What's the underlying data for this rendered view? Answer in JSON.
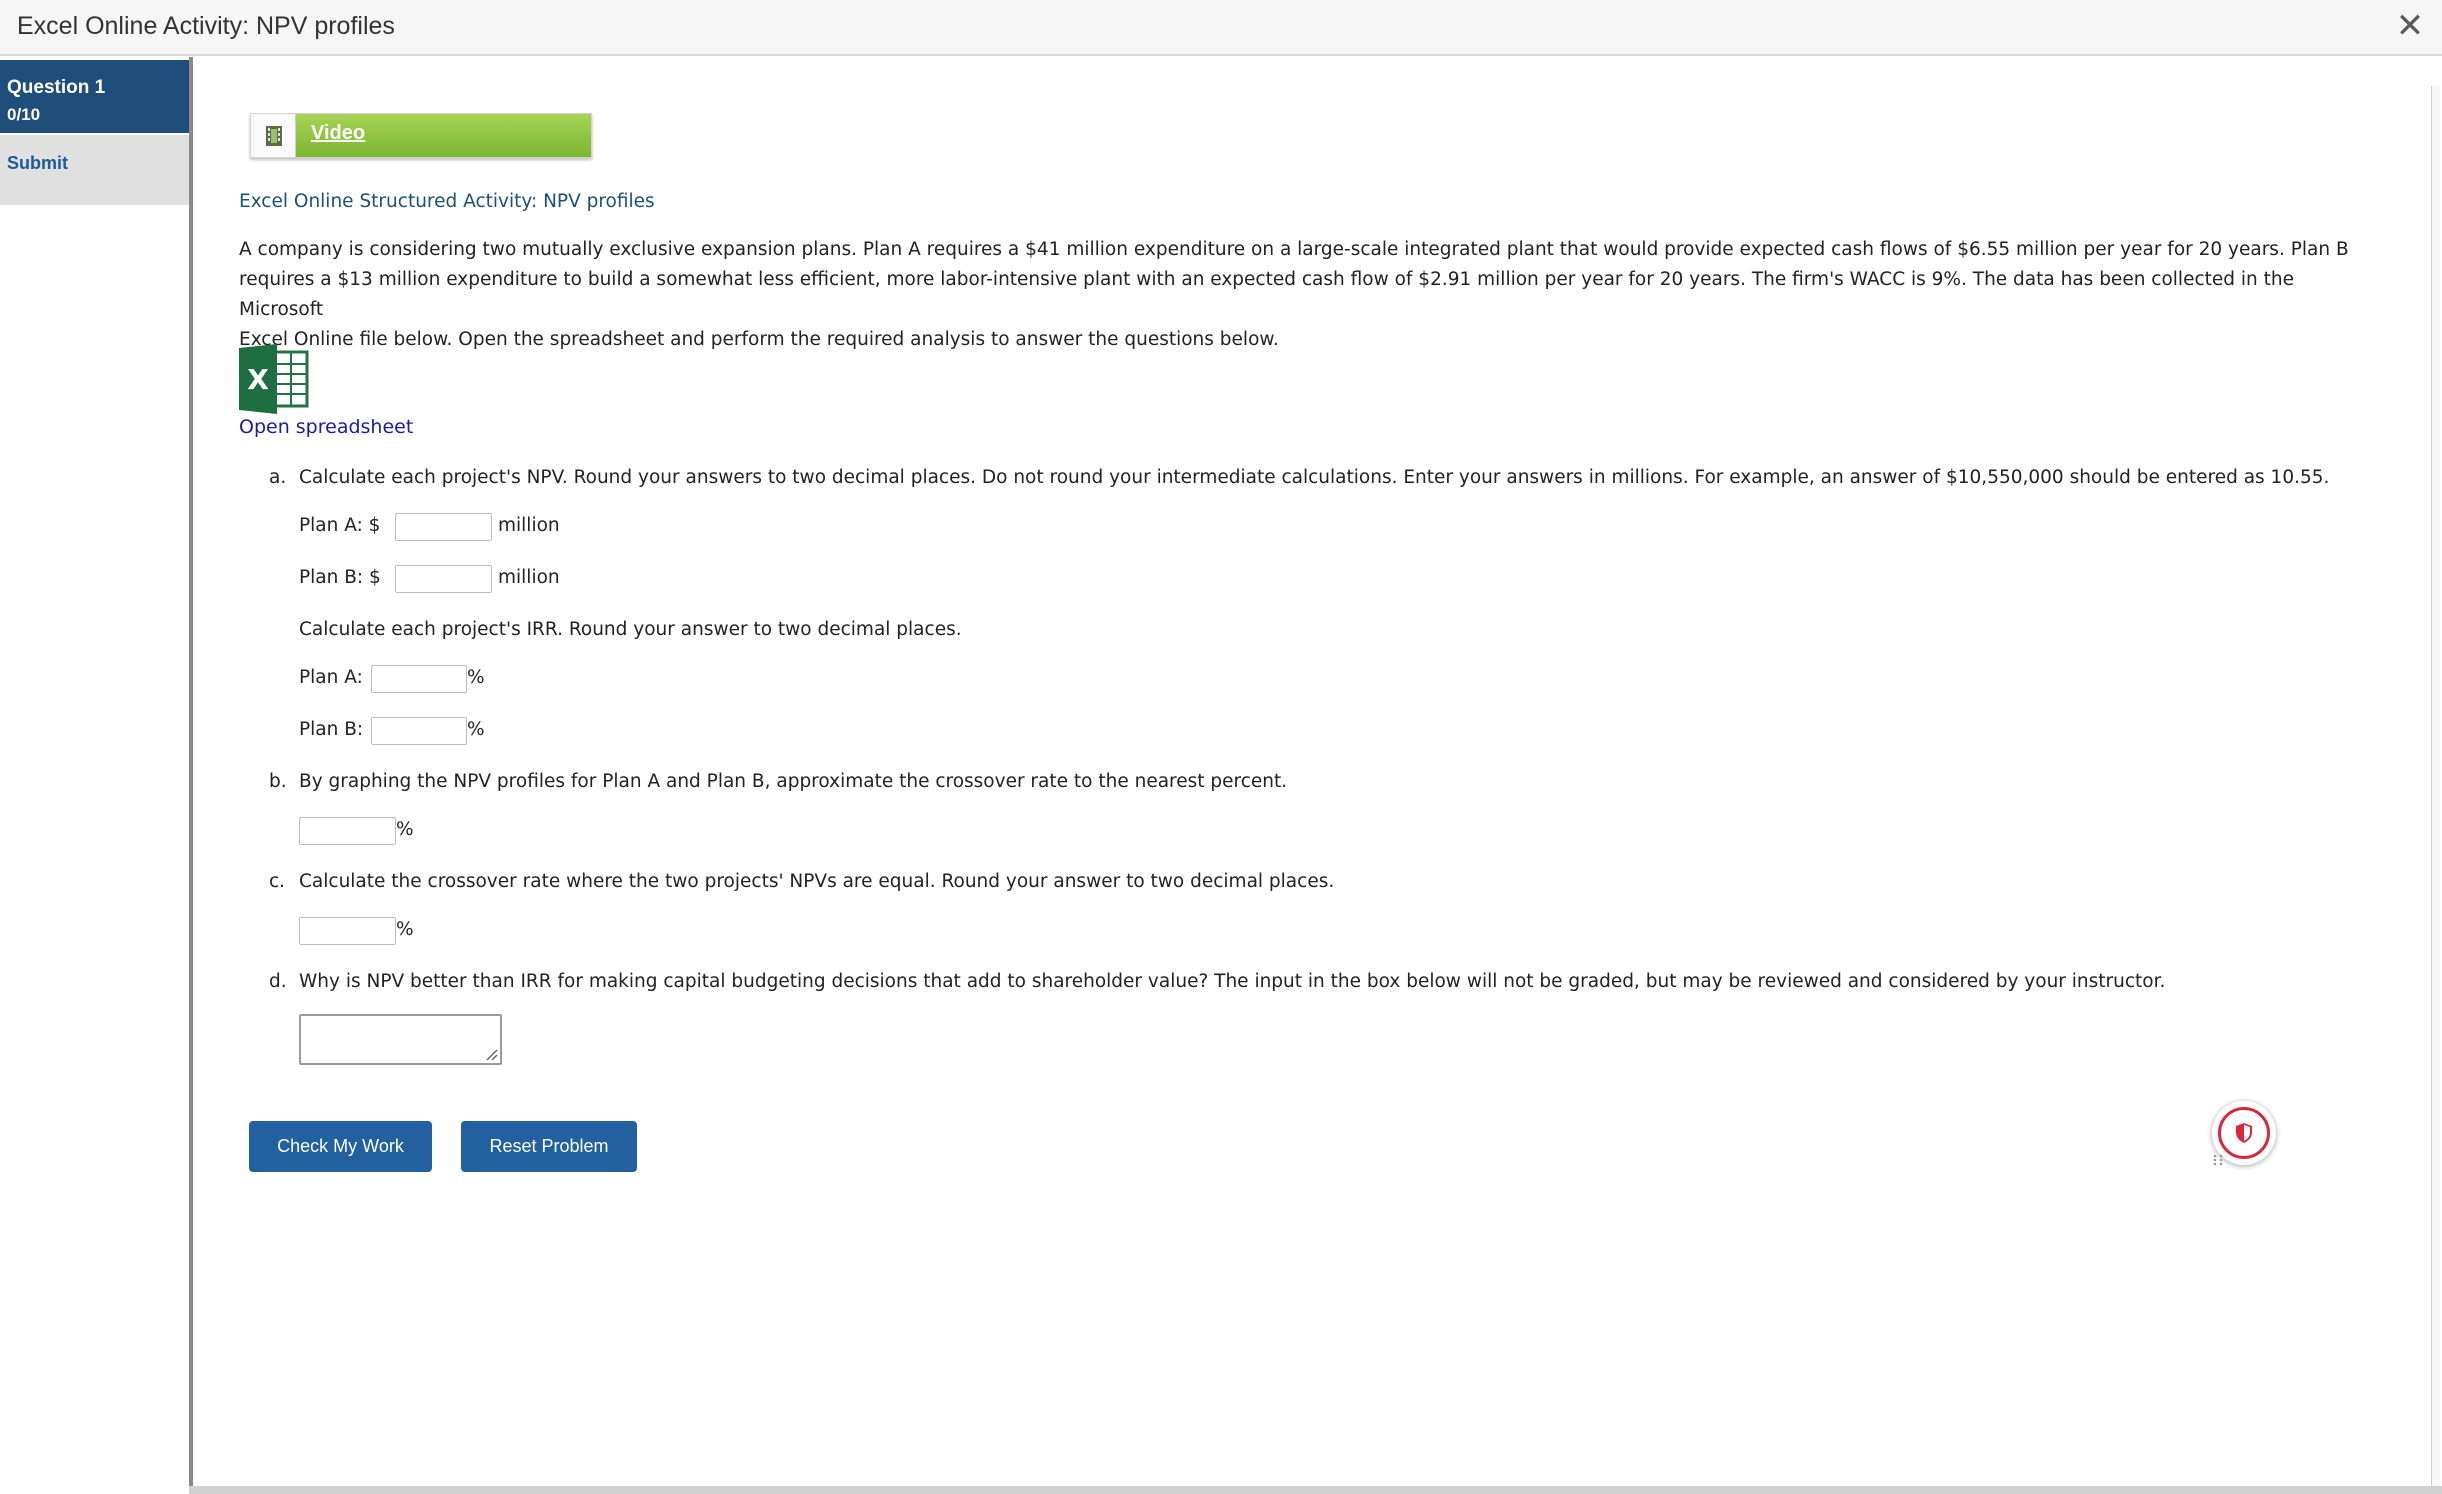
{
  "window": {
    "title": "Excel Online Activity: NPV profiles",
    "close_icon": "close-x-icon"
  },
  "sidebar": {
    "question_label": "Question 1",
    "score": "0/10",
    "submit_label": "Submit"
  },
  "video": {
    "label": "Video",
    "icon": "film-strip-icon"
  },
  "activity": {
    "title": "Excel Online Structured Activity: NPV profiles",
    "intro_line1": "A company is considering two mutually exclusive expansion plans. Plan A requires a $41 million expenditure on a large-scale integrated plant that would provide expected cash flows of $6.55 million per year for 20 years. Plan B",
    "intro_line2": "requires a $13 million expenditure to build a somewhat less efficient, more labor-intensive plant with an expected cash flow of $2.91 million per year for 20 years. The firm's WACC is 9%. The data has been collected in the Microsoft",
    "intro_line3": "Excel Online file below. Open the spreadsheet and perform the required analysis to answer the questions below.",
    "excel_icon": "excel-icon",
    "open_link": "Open spreadsheet"
  },
  "questions": {
    "a": {
      "letter": "a.",
      "text": "Calculate each project's NPV. Round your answers to two decimal places. Do not round your intermediate calculations. Enter your answers in millions. For example, an answer of $10,550,000 should be entered as 10.55.",
      "plan_a_label": "Plan A: $",
      "plan_b_label": "Plan B: $",
      "unit": "million",
      "irr_text": "Calculate each project's IRR. Round your answer to two decimal places.",
      "irr_plan_a_label": "Plan A:",
      "irr_plan_b_label": "Plan B:",
      "percent": "%",
      "npv_a_value": "",
      "npv_b_value": "",
      "irr_a_value": "",
      "irr_b_value": ""
    },
    "b": {
      "letter": "b.",
      "text": "By graphing the NPV profiles for Plan A and Plan B, approximate the crossover rate to the nearest percent.",
      "percent": "%",
      "value": ""
    },
    "c": {
      "letter": "c.",
      "text": "Calculate the crossover rate where the two projects' NPVs are equal. Round your answer to two decimal places.",
      "percent": "%",
      "value": ""
    },
    "d": {
      "letter": "d.",
      "text": "Why is NPV better than IRR for making capital budgeting decisions that add to shareholder value? The input in the box below will not be graded, but may be reviewed and considered by your instructor.",
      "value": ""
    }
  },
  "buttons": {
    "check": "Check My Work",
    "reset": "Reset Problem"
  },
  "floating": {
    "icon": "shield-icon",
    "accent": "#d9263a"
  },
  "colors": {
    "sidebar_active": "#1e4e79",
    "button": "#2260a0",
    "video_green": "#8cc63f",
    "link": "#1a1aa6"
  }
}
